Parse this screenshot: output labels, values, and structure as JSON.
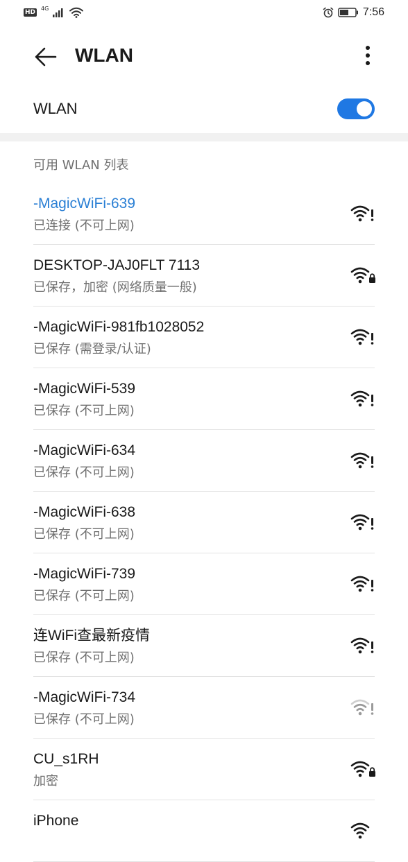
{
  "status_bar": {
    "hd": "HD",
    "network": "4G",
    "time": "7:56"
  },
  "header": {
    "title": "WLAN",
    "back_icon": "back-arrow-icon",
    "more_icon": "more-vert-icon"
  },
  "wlan_toggle": {
    "label": "WLAN",
    "enabled": true,
    "accent_color": "#1f78e3"
  },
  "available_section": {
    "title": "可用 WLAN 列表"
  },
  "networks": [
    {
      "name": "-MagicWiFi-639",
      "status": "已连接 (不可上网)",
      "connected": true,
      "icon": "wifi-no-internet-icon",
      "color": "#2a7fd4"
    },
    {
      "name": "DESKTOP-JAJ0FLT 7113",
      "status": "已保存，加密 (网络质量一般)",
      "connected": false,
      "icon": "wifi-lock-icon"
    },
    {
      "name": "-MagicWiFi-981fb1028052",
      "status": "已保存 (需登录/认证)",
      "connected": false,
      "icon": "wifi-no-internet-icon"
    },
    {
      "name": "-MagicWiFi-539",
      "status": "已保存 (不可上网)",
      "connected": false,
      "icon": "wifi-no-internet-icon"
    },
    {
      "name": "-MagicWiFi-634",
      "status": "已保存 (不可上网)",
      "connected": false,
      "icon": "wifi-no-internet-icon"
    },
    {
      "name": "-MagicWiFi-638",
      "status": "已保存 (不可上网)",
      "connected": false,
      "icon": "wifi-no-internet-icon"
    },
    {
      "name": "-MagicWiFi-739",
      "status": "已保存 (不可上网)",
      "connected": false,
      "icon": "wifi-no-internet-icon"
    },
    {
      "name": "连WiFi查最新疫情",
      "status": "已保存 (不可上网)",
      "connected": false,
      "icon": "wifi-no-internet-icon"
    },
    {
      "name": "-MagicWiFi-734",
      "status": "已保存 (不可上网)",
      "connected": false,
      "icon": "wifi-weak-no-internet-icon"
    },
    {
      "name": "CU_s1RH",
      "status": "加密",
      "connected": false,
      "icon": "wifi-lock-icon"
    },
    {
      "name": "iPhone",
      "status": "",
      "connected": false,
      "icon": "wifi-icon"
    }
  ]
}
